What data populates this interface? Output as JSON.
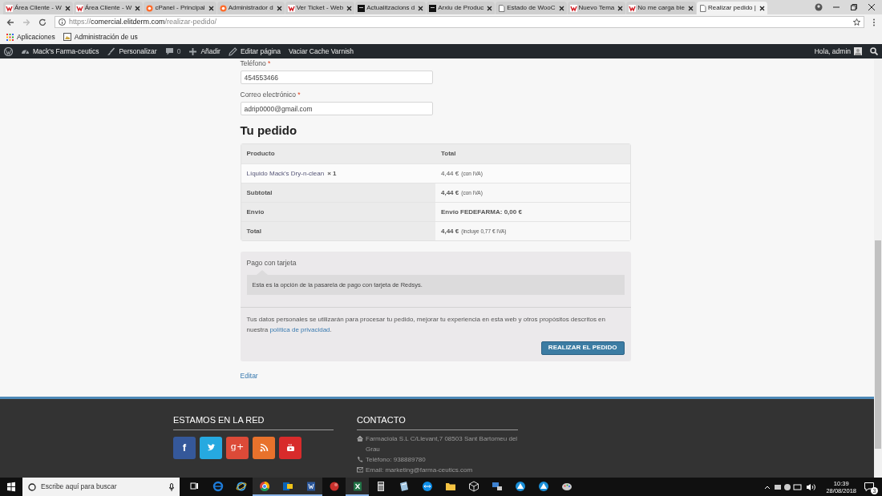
{
  "browser": {
    "tabs": [
      {
        "title": "Área Cliente - W",
        "kind": "w",
        "selected": false
      },
      {
        "title": "Área Cliente - W",
        "kind": "w",
        "selected": false
      },
      {
        "title": "cPanel - Principal",
        "kind": "cp",
        "selected": false
      },
      {
        "title": "Administrador d",
        "kind": "cp",
        "selected": false
      },
      {
        "title": "Ver Ticket - Web",
        "kind": "w",
        "selected": false
      },
      {
        "title": "Actualitzacions d",
        "kind": "dark",
        "selected": false
      },
      {
        "title": "Arxiu de Produc",
        "kind": "dark",
        "selected": false
      },
      {
        "title": "Estado de WooC",
        "kind": "page",
        "selected": false
      },
      {
        "title": "Nuevo Tema",
        "kind": "w",
        "selected": false
      },
      {
        "title": "No me carga bie",
        "kind": "w",
        "selected": false
      },
      {
        "title": "Realizar pedido |",
        "kind": "page",
        "selected": true
      }
    ],
    "url": {
      "scheme": "https://",
      "host": "comercial.elitderm.com",
      "path": "/realizar-pedido/"
    },
    "bookmarks": [
      {
        "label": "Aplicaciones",
        "kind": "apps"
      },
      {
        "label": "Administración de us",
        "kind": "image"
      }
    ]
  },
  "admin_bar": {
    "items": [
      {
        "kind": "wp"
      },
      {
        "kind": "site",
        "label": "Mack's Farma-ceutics"
      },
      {
        "kind": "brush",
        "label": "Personalizar"
      },
      {
        "kind": "comments",
        "label": "0"
      },
      {
        "kind": "plus",
        "label": "Añadir"
      },
      {
        "kind": "pencil",
        "label": "Editar página"
      },
      {
        "kind": "text",
        "label": "Vaciar Cache Varnish"
      }
    ],
    "greeting": "Hola, admin"
  },
  "checkout": {
    "fields": [
      {
        "label": "Teléfono",
        "required_mark": "*",
        "value": "454553466"
      },
      {
        "label": "Correo electrónico",
        "required_mark": "*",
        "value": "adrip0000@gmail.com"
      }
    ],
    "order_heading": "Tu pedido",
    "columns": [
      "Producto",
      "Total"
    ],
    "rows": [
      {
        "kind": "item",
        "label": "Líquido Mack's Dry-n-clean",
        "qty": "× 1",
        "amount": "4,44 €",
        "note": "(con IVA)"
      },
      {
        "kind": "summary",
        "label": "Subtotal",
        "amount": "4,44 €",
        "note": "(con IVA)"
      },
      {
        "kind": "summary",
        "label": "Envío",
        "amount": "Envío FEDEFARMA: 0,00 €"
      },
      {
        "kind": "summary",
        "label": "Total",
        "amount": "4,44 €",
        "note": "(incluye 0,77 € IVA)"
      }
    ],
    "payment": {
      "method": "Pago con tarjeta",
      "description": "Esta es la opción de la pasarela de pago con tarjeta de Redsys.",
      "privacy_before": "Tus datos personales se utilizarán para procesar tu pedido, mejorar tu experiencia en esta web y otros propósitos descritos en nuestra ",
      "privacy_link": "política de privacidad",
      "privacy_after": ".",
      "button": "REALIZAR EL PEDIDO"
    },
    "edit_link": "Editar"
  },
  "footer": {
    "social": {
      "heading": "ESTAMOS EN LA RED",
      "buttons": [
        {
          "kind": "facebook",
          "label": "f"
        },
        {
          "kind": "twitter"
        },
        {
          "kind": "gplus",
          "label": "g+"
        },
        {
          "kind": "rss"
        },
        {
          "kind": "youtube"
        }
      ]
    },
    "contact": {
      "heading": "CONTACTO",
      "lines": [
        {
          "kind": "home",
          "text": "Farmaciola S.L C/Llevant,7 08503 Sant Bartomeu del Grau"
        },
        {
          "kind": "phone",
          "text": "Teléfono: 938889780"
        },
        {
          "kind": "mail",
          "text": "Email: marketing@farma-ceutics.com"
        }
      ]
    }
  },
  "taskbar": {
    "search_placeholder": "Escribe aquí para buscar",
    "apps": [
      {
        "kind": "taskview",
        "selected": false
      },
      {
        "kind": "edge",
        "selected": false
      },
      {
        "kind": "ie",
        "selected": false
      },
      {
        "kind": "chrome",
        "selected": true
      },
      {
        "kind": "outlook",
        "selected": true
      },
      {
        "kind": "word",
        "selected": true
      },
      {
        "kind": "red",
        "selected": false
      },
      {
        "kind": "excel",
        "selected": true
      },
      {
        "kind": "calc",
        "selected": false
      },
      {
        "kind": "notes",
        "selected": false
      },
      {
        "kind": "remote",
        "selected": false
      },
      {
        "kind": "folder",
        "selected": false
      },
      {
        "kind": "cube",
        "selected": false
      },
      {
        "kind": "network",
        "selected": false
      },
      {
        "kind": "triangle",
        "selected": false
      },
      {
        "kind": "triangle",
        "selected": false
      },
      {
        "kind": "paint",
        "selected": false
      }
    ],
    "time": "10:39",
    "date": "28/08/2018",
    "notifications": "3"
  }
}
